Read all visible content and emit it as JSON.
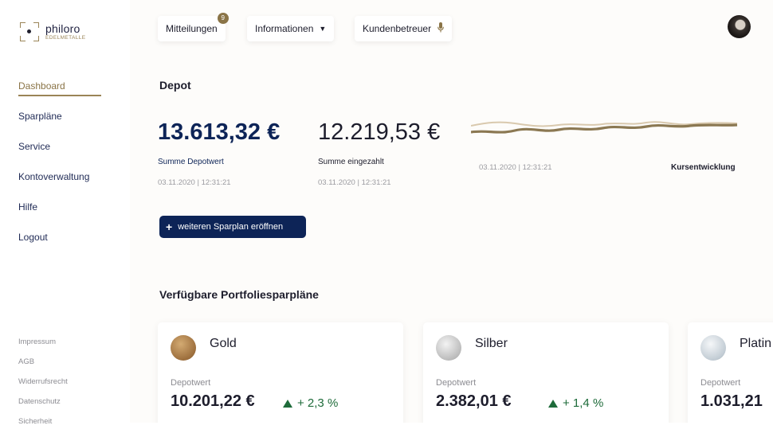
{
  "brand": {
    "name": "philoro",
    "sub": "EDELMETALLE"
  },
  "sidebar": {
    "items": [
      {
        "label": "Dashboard"
      },
      {
        "label": "Sparpläne"
      },
      {
        "label": "Service"
      },
      {
        "label": "Kontoverwaltung"
      },
      {
        "label": "Hilfe"
      },
      {
        "label": "Logout"
      }
    ],
    "footer": [
      "Impressum",
      "AGB",
      "Widerrufsrecht",
      "Datenschutz",
      "Sicherheit"
    ]
  },
  "topbar": {
    "messages_label": "Mitteilungen",
    "messages_count": "9",
    "info_label": "Informationen",
    "advisor_label": "Kundenbetreuer"
  },
  "depot": {
    "title": "Depot",
    "total_value": "13.613,32 €",
    "total_label": "Summe Depotwert",
    "total_ts": "03.11.2020  |  12:31:21",
    "paid_value": "12.219,53 €",
    "paid_label": "Summe eingezahlt",
    "paid_ts": "03.11.2020  |  12:31:21",
    "chart_ts": "03.11.2020  |  12:31:21",
    "chart_label": "Kursentwicklung",
    "cta_label": "weiteren Sparplan eröffnen"
  },
  "portfolio": {
    "title": "Verfügbare Portfoliesparpläne",
    "cards": [
      {
        "name": "Gold",
        "label": "Depotwert",
        "value": "10.201,22 €",
        "change": "+ 2,3 %"
      },
      {
        "name": "Silber",
        "label": "Depotwert",
        "value": "2.382,01 €",
        "change": "+ 1,4 %"
      },
      {
        "name": "Platin",
        "label": "Depotwert",
        "value": "1.031,21"
      }
    ]
  }
}
